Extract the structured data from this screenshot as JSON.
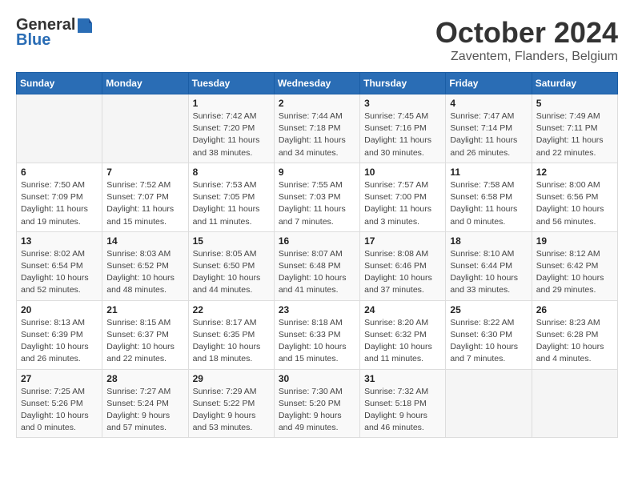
{
  "header": {
    "logo_general": "General",
    "logo_blue": "Blue",
    "title": "October 2024",
    "subtitle": "Zaventem, Flanders, Belgium"
  },
  "weekdays": [
    "Sunday",
    "Monday",
    "Tuesday",
    "Wednesday",
    "Thursday",
    "Friday",
    "Saturday"
  ],
  "weeks": [
    [
      {
        "day": "",
        "sunrise": "",
        "sunset": "",
        "daylight": ""
      },
      {
        "day": "",
        "sunrise": "",
        "sunset": "",
        "daylight": ""
      },
      {
        "day": "1",
        "sunrise": "Sunrise: 7:42 AM",
        "sunset": "Sunset: 7:20 PM",
        "daylight": "Daylight: 11 hours and 38 minutes."
      },
      {
        "day": "2",
        "sunrise": "Sunrise: 7:44 AM",
        "sunset": "Sunset: 7:18 PM",
        "daylight": "Daylight: 11 hours and 34 minutes."
      },
      {
        "day": "3",
        "sunrise": "Sunrise: 7:45 AM",
        "sunset": "Sunset: 7:16 PM",
        "daylight": "Daylight: 11 hours and 30 minutes."
      },
      {
        "day": "4",
        "sunrise": "Sunrise: 7:47 AM",
        "sunset": "Sunset: 7:14 PM",
        "daylight": "Daylight: 11 hours and 26 minutes."
      },
      {
        "day": "5",
        "sunrise": "Sunrise: 7:49 AM",
        "sunset": "Sunset: 7:11 PM",
        "daylight": "Daylight: 11 hours and 22 minutes."
      }
    ],
    [
      {
        "day": "6",
        "sunrise": "Sunrise: 7:50 AM",
        "sunset": "Sunset: 7:09 PM",
        "daylight": "Daylight: 11 hours and 19 minutes."
      },
      {
        "day": "7",
        "sunrise": "Sunrise: 7:52 AM",
        "sunset": "Sunset: 7:07 PM",
        "daylight": "Daylight: 11 hours and 15 minutes."
      },
      {
        "day": "8",
        "sunrise": "Sunrise: 7:53 AM",
        "sunset": "Sunset: 7:05 PM",
        "daylight": "Daylight: 11 hours and 11 minutes."
      },
      {
        "day": "9",
        "sunrise": "Sunrise: 7:55 AM",
        "sunset": "Sunset: 7:03 PM",
        "daylight": "Daylight: 11 hours and 7 minutes."
      },
      {
        "day": "10",
        "sunrise": "Sunrise: 7:57 AM",
        "sunset": "Sunset: 7:00 PM",
        "daylight": "Daylight: 11 hours and 3 minutes."
      },
      {
        "day": "11",
        "sunrise": "Sunrise: 7:58 AM",
        "sunset": "Sunset: 6:58 PM",
        "daylight": "Daylight: 11 hours and 0 minutes."
      },
      {
        "day": "12",
        "sunrise": "Sunrise: 8:00 AM",
        "sunset": "Sunset: 6:56 PM",
        "daylight": "Daylight: 10 hours and 56 minutes."
      }
    ],
    [
      {
        "day": "13",
        "sunrise": "Sunrise: 8:02 AM",
        "sunset": "Sunset: 6:54 PM",
        "daylight": "Daylight: 10 hours and 52 minutes."
      },
      {
        "day": "14",
        "sunrise": "Sunrise: 8:03 AM",
        "sunset": "Sunset: 6:52 PM",
        "daylight": "Daylight: 10 hours and 48 minutes."
      },
      {
        "day": "15",
        "sunrise": "Sunrise: 8:05 AM",
        "sunset": "Sunset: 6:50 PM",
        "daylight": "Daylight: 10 hours and 44 minutes."
      },
      {
        "day": "16",
        "sunrise": "Sunrise: 8:07 AM",
        "sunset": "Sunset: 6:48 PM",
        "daylight": "Daylight: 10 hours and 41 minutes."
      },
      {
        "day": "17",
        "sunrise": "Sunrise: 8:08 AM",
        "sunset": "Sunset: 6:46 PM",
        "daylight": "Daylight: 10 hours and 37 minutes."
      },
      {
        "day": "18",
        "sunrise": "Sunrise: 8:10 AM",
        "sunset": "Sunset: 6:44 PM",
        "daylight": "Daylight: 10 hours and 33 minutes."
      },
      {
        "day": "19",
        "sunrise": "Sunrise: 8:12 AM",
        "sunset": "Sunset: 6:42 PM",
        "daylight": "Daylight: 10 hours and 29 minutes."
      }
    ],
    [
      {
        "day": "20",
        "sunrise": "Sunrise: 8:13 AM",
        "sunset": "Sunset: 6:39 PM",
        "daylight": "Daylight: 10 hours and 26 minutes."
      },
      {
        "day": "21",
        "sunrise": "Sunrise: 8:15 AM",
        "sunset": "Sunset: 6:37 PM",
        "daylight": "Daylight: 10 hours and 22 minutes."
      },
      {
        "day": "22",
        "sunrise": "Sunrise: 8:17 AM",
        "sunset": "Sunset: 6:35 PM",
        "daylight": "Daylight: 10 hours and 18 minutes."
      },
      {
        "day": "23",
        "sunrise": "Sunrise: 8:18 AM",
        "sunset": "Sunset: 6:33 PM",
        "daylight": "Daylight: 10 hours and 15 minutes."
      },
      {
        "day": "24",
        "sunrise": "Sunrise: 8:20 AM",
        "sunset": "Sunset: 6:32 PM",
        "daylight": "Daylight: 10 hours and 11 minutes."
      },
      {
        "day": "25",
        "sunrise": "Sunrise: 8:22 AM",
        "sunset": "Sunset: 6:30 PM",
        "daylight": "Daylight: 10 hours and 7 minutes."
      },
      {
        "day": "26",
        "sunrise": "Sunrise: 8:23 AM",
        "sunset": "Sunset: 6:28 PM",
        "daylight": "Daylight: 10 hours and 4 minutes."
      }
    ],
    [
      {
        "day": "27",
        "sunrise": "Sunrise: 7:25 AM",
        "sunset": "Sunset: 5:26 PM",
        "daylight": "Daylight: 10 hours and 0 minutes."
      },
      {
        "day": "28",
        "sunrise": "Sunrise: 7:27 AM",
        "sunset": "Sunset: 5:24 PM",
        "daylight": "Daylight: 9 hours and 57 minutes."
      },
      {
        "day": "29",
        "sunrise": "Sunrise: 7:29 AM",
        "sunset": "Sunset: 5:22 PM",
        "daylight": "Daylight: 9 hours and 53 minutes."
      },
      {
        "day": "30",
        "sunrise": "Sunrise: 7:30 AM",
        "sunset": "Sunset: 5:20 PM",
        "daylight": "Daylight: 9 hours and 49 minutes."
      },
      {
        "day": "31",
        "sunrise": "Sunrise: 7:32 AM",
        "sunset": "Sunset: 5:18 PM",
        "daylight": "Daylight: 9 hours and 46 minutes."
      },
      {
        "day": "",
        "sunrise": "",
        "sunset": "",
        "daylight": ""
      },
      {
        "day": "",
        "sunrise": "",
        "sunset": "",
        "daylight": ""
      }
    ]
  ]
}
